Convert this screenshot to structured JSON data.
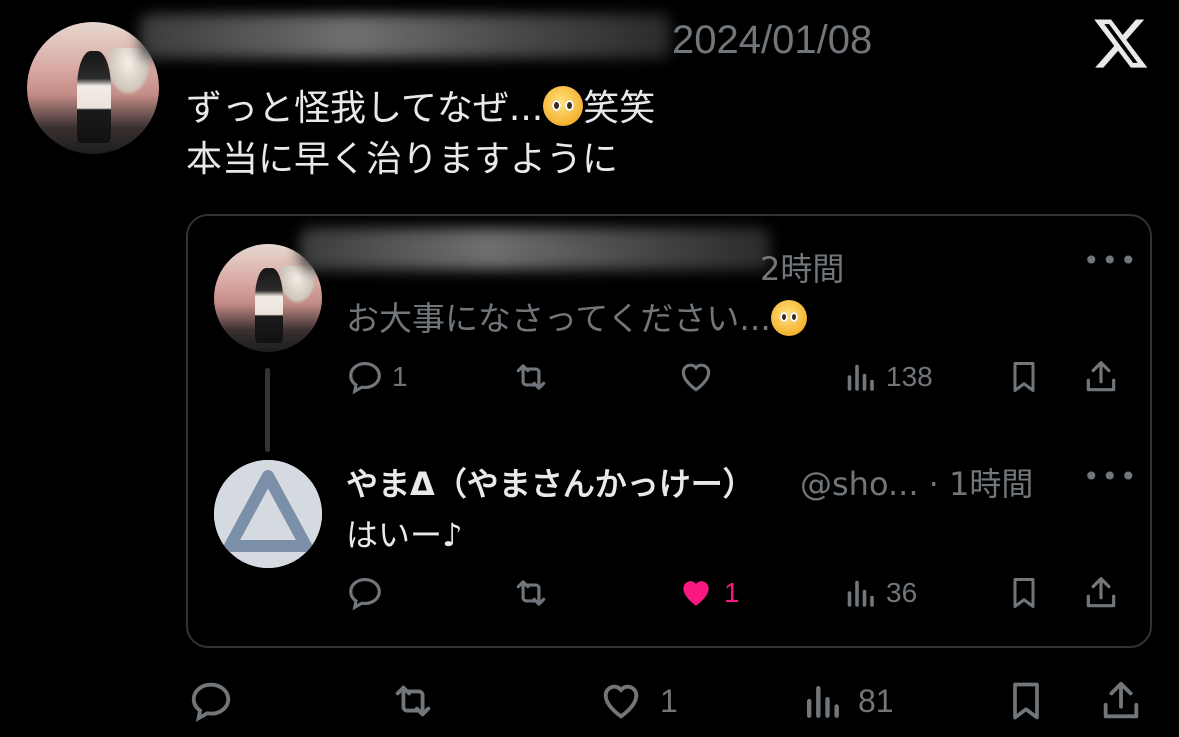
{
  "post": {
    "date": "2024/01/08",
    "text_line1": "ずっと怪我してなぜ...",
    "text_line1_suffix": "笑笑",
    "text_line2": "本当に早く治りますように",
    "actions": {
      "likes": "1",
      "views": "81"
    }
  },
  "quote": {
    "reply1": {
      "time": "2時間",
      "text": "お大事になさってください...",
      "actions": {
        "replies": "1",
        "views": "138"
      }
    },
    "reply2": {
      "display_name": "やまΔ（やまさんかっけー）",
      "handle_time": "@sho... · 1時間",
      "text": "はいー♪",
      "actions": {
        "likes": "1",
        "views": "36"
      }
    }
  },
  "icons": [
    "x-logo",
    "reply-icon",
    "retweet-icon",
    "like-icon",
    "views-icon",
    "bookmark-icon",
    "share-icon",
    "more-icon",
    "pleading-face-emoji"
  ],
  "colors": {
    "background": "#000000",
    "text": "#e7e9ea",
    "muted": "#71767b",
    "like_active": "#f91880",
    "border": "#2f3336"
  }
}
